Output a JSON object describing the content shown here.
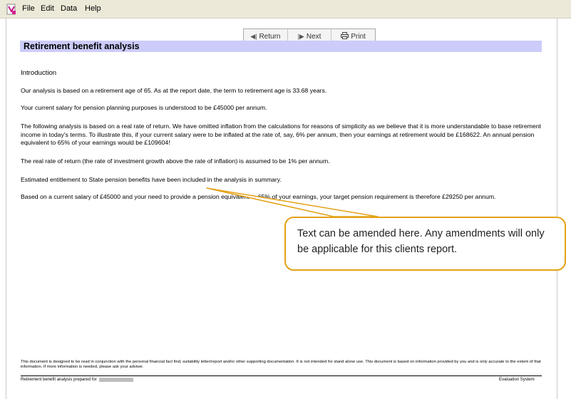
{
  "menu": {
    "items": [
      "File",
      "Edit",
      "Data",
      "Help"
    ]
  },
  "toolbar": {
    "return_label": "Return",
    "next_label": "Next",
    "print_label": "Print"
  },
  "report": {
    "title": "Retirement benefit analysis",
    "section": "Introduction",
    "paragraphs": [
      "Our analysis is based on a retirement age of 65. As at the report date, the term to retirement age is 33.68 years.",
      "Your current salary for pension planning purposes is understood to be £45000 per annum.",
      "The following analysis is based on a real rate of return. We have omitted inflation from the calculations for reasons of simplicity as we believe that it is more understandable to base retirement income in today's terms. To illustrate this, if your current salary were to be inflated at the rate of, say, 6% per annum, then your earnings at retirement would be £168622. An annual pension equivalent to 65% of your earnings would be £109604!",
      "The real rate of return (the rate of investment growth above the rate of inflation) is assumed to be 1% per annum.",
      "Estimated entitlement to State pension benefits have been included in the analysis in summary.",
      "Based on a current salary of £45000 and your need to provide a pension equivalent to 65% of your earnings, your target pension requirement is therefore £29250 per annum."
    ]
  },
  "callout": {
    "text": "Text can be amended here.  Any amendments will only be applicable for this clients report."
  },
  "footer": {
    "disclaimer": "This document is designed to be read in conjunction with the personal financial fact find, suitability letter/report and/or other supporting documentation.  It is not intended for stand alone use.  This document is based on information provided by you and is only accurate to the extent of that information.  If more information is needed, please ask your adviser.",
    "prepared_for": "Retirement benefit analysis prepared for",
    "system": "Evaluation System"
  },
  "colors": {
    "title_bar": "#ccccfa",
    "callout_border": "#e3a216"
  }
}
